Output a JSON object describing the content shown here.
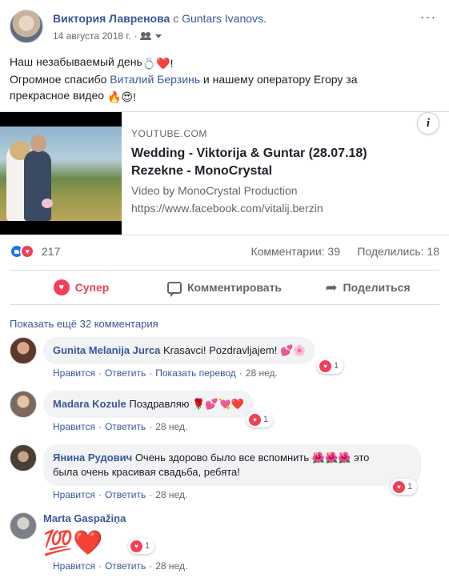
{
  "post": {
    "author": "Виктория Лавренова",
    "with_prefix": "с",
    "with_name": "Guntars Ivanovs.",
    "date": "14 августа 2018 г.",
    "date_sep": "·",
    "more_icon": "ellipsis-icon",
    "text_line1": "Наш незабываемый день",
    "text_line1_emoji": "💍❤️!",
    "text_line2_pre": "Огромное спасибо ",
    "text_line2_link": "Виталий Берзинь",
    "text_line2_post": " и нашему оператору Егору за",
    "text_line3": "прекрасное видео",
    "text_line3_emoji": "🔥😍!"
  },
  "link_card": {
    "domain": "YOUTUBE.COM",
    "title": "Wedding - Viktorija & Guntar (28.07.18) Rezekne - MonoCrystal",
    "subtitle": "Video by MonoCrystal Production",
    "url": "https://www.facebook.com/vitalij.berzin",
    "info_label": "i"
  },
  "stats": {
    "reaction_count": "217",
    "comments": "Комментарии: 39",
    "shares": "Поделились: 18"
  },
  "actions": {
    "love": "Супер",
    "comment": "Комментировать",
    "share": "Поделиться"
  },
  "more_comments": "Показать ещё 32 комментария",
  "comments": [
    {
      "name": "Gunita Melanija Jurca",
      "text": "Krasavci! Pozdravljajem!",
      "emoji": "💕🌸",
      "reactions": "1",
      "like": "Нравится",
      "reply": "Ответить",
      "translate": "Показать перевод",
      "time": "28 нед."
    },
    {
      "name": "Madara Kozule",
      "text": "Поздравляю",
      "emoji": "🌹💕💘❤️",
      "reactions": "1",
      "like": "Нравится",
      "reply": "Ответить",
      "time": "28 нед."
    },
    {
      "name": "Янина Рудович",
      "text_a": "Очень здорово было все вспомнить",
      "emoji": "🌺🌺🌺",
      "text_b": "это",
      "text_c": "была очень красивая свадьба, ребята!",
      "reactions": "1",
      "like": "Нравится",
      "reply": "Ответить",
      "time": "28 нед."
    },
    {
      "name": "Marta Gaspažiņa",
      "emoji": "💯❤️",
      "reactions": "1",
      "like": "Нравится",
      "reply": "Ответить",
      "time": "28 нед."
    }
  ],
  "colors": {
    "link": "#385898",
    "like_blue": "#1877f2",
    "love_red": "#f33e58",
    "muted": "#606770"
  }
}
